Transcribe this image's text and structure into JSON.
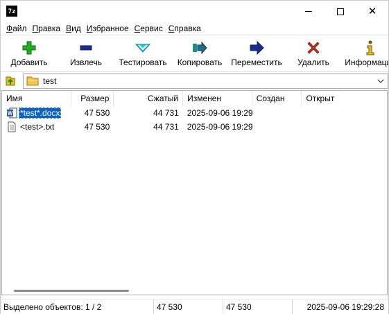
{
  "window": {
    "app_icon_text": "7z"
  },
  "menu": [
    {
      "label": "Файл",
      "key": "Ф",
      "rest": "айл"
    },
    {
      "label": "Правка",
      "key": "П",
      "rest": "равка"
    },
    {
      "label": "Вид",
      "key": "В",
      "rest": "ид"
    },
    {
      "label": "Избранное",
      "key": "И",
      "rest": "збранное"
    },
    {
      "label": "Сервис",
      "key": "С",
      "rest": "ервис"
    },
    {
      "label": "Справка",
      "key": "С",
      "rest": "правка"
    }
  ],
  "toolbar": {
    "add": "Добавить",
    "extract": "Извлечь",
    "test": "Тестировать",
    "copy": "Копировать",
    "move": "Переместить",
    "delete": "Удалить",
    "info": "Информация"
  },
  "address": {
    "path": "test"
  },
  "columns": {
    "name": "Имя",
    "size": "Размер",
    "packed": "Сжатый",
    "modified": "Изменен",
    "created": "Создан",
    "accessed": "Открыт"
  },
  "files": [
    {
      "name": "*test*.docx",
      "size": "47 530",
      "packed": "44 731",
      "modified": "2025-09-06 19:29",
      "created": "",
      "accessed": "",
      "icon": "word-document-icon",
      "selected": true
    },
    {
      "name": "<test>.txt",
      "size": "47 530",
      "packed": "44 731",
      "modified": "2025-09-06 19:29",
      "created": "",
      "accessed": "",
      "icon": "text-file-icon",
      "selected": false
    }
  ],
  "status": {
    "selected": "Выделено объектов: 1 / 2",
    "size": "47 530",
    "packed": "47 530",
    "modified": "2025-09-06 19:29:28"
  },
  "colors": {
    "selection": "#0b61c4",
    "add_green": "#1fae1f",
    "extract_blue": "#1a2d8f",
    "test_cyan": "#2ec4d6",
    "delete_red": "#c0331f"
  }
}
